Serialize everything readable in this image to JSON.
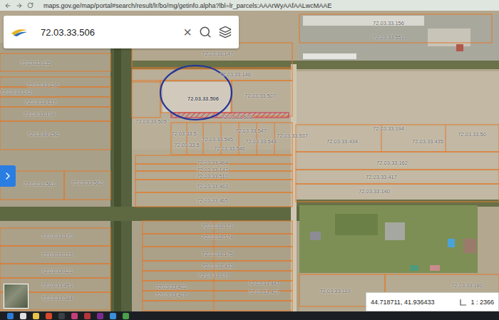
{
  "browser": {
    "url": "maps.gov.ge/map/portal#search/result/lr/bo/mg/getinfo.alpha?lbl=lr_parcels:AAArWyAAfAALwcMAAE"
  },
  "search": {
    "value": "72.03.33.506",
    "clear": "×"
  },
  "parcels": [
    {
      "label": "72.03.33.156",
      "selected": false
    },
    {
      "label": "72.03.33.551",
      "selected": false
    },
    {
      "label": "72.03.33.147",
      "selected": false
    },
    {
      "label": "72.03.33.135",
      "selected": false
    },
    {
      "label": "72.03.33.146",
      "selected": false
    },
    {
      "label": "72.03.33.136",
      "selected": false
    },
    {
      "label": "72.03.33.192",
      "selected": false
    },
    {
      "label": "72.03.33.137",
      "selected": false
    },
    {
      "label": "72.03.33.506",
      "selected": true
    },
    {
      "label": "72.03.33.507",
      "selected": false
    },
    {
      "label": "72.03.33.138",
      "selected": false
    },
    {
      "label": "72.03.33.505",
      "selected": false
    },
    {
      "label": "72.03.33.508",
      "selected": false
    },
    {
      "label": "72.03.33.156",
      "selected": false
    },
    {
      "label": "72.03.33.194",
      "selected": false
    },
    {
      "label": "72.03.33.50",
      "selected": false
    },
    {
      "label": "72.03.33.537",
      "selected": false
    },
    {
      "label": "72.03.33.547",
      "selected": false
    },
    {
      "label": "72.03.33.5",
      "selected": false
    },
    {
      "label": "72.03.33.545",
      "selected": false
    },
    {
      "label": "72.03.33.548",
      "selected": false
    },
    {
      "label": "72.03.33.434",
      "selected": false
    },
    {
      "label": "72.03.33.435",
      "selected": false
    },
    {
      "label": "72.03.33.5",
      "selected": false
    },
    {
      "label": "72.03.33.546",
      "selected": false
    },
    {
      "label": "72.03.33.464",
      "selected": false
    },
    {
      "label": "72.03.33.162",
      "selected": false
    },
    {
      "label": "72.03.33.142",
      "selected": false
    },
    {
      "label": "72.03.33.510",
      "selected": false
    },
    {
      "label": "72.03.33.561",
      "selected": false
    },
    {
      "label": "72.03.33.562",
      "selected": false
    },
    {
      "label": "72.03.33.417",
      "selected": false
    },
    {
      "label": "72.03.33.463",
      "selected": false
    },
    {
      "label": "72.03.33.140",
      "selected": false
    },
    {
      "label": "72.03.33.465",
      "selected": false
    },
    {
      "label": "72.03.33.171",
      "selected": false
    },
    {
      "label": "72.03.33.170",
      "selected": false
    },
    {
      "label": "72.03.33.174",
      "selected": false
    },
    {
      "label": "72.03.33.113",
      "selected": false
    },
    {
      "label": "72.03.33.175",
      "selected": false
    },
    {
      "label": "72.03.33.433",
      "selected": false
    },
    {
      "label": "72.03.33.121",
      "selected": false
    },
    {
      "label": "72.03.33.177",
      "selected": false
    },
    {
      "label": "72.03.33.451",
      "selected": false
    },
    {
      "label": "72.03.33.443",
      "selected": false
    },
    {
      "label": "72.03.33.422",
      "selected": false
    },
    {
      "label": "72.03.33.119",
      "selected": false
    },
    {
      "label": "72.03.33.427",
      "selected": false
    },
    {
      "label": "72.03.33.426",
      "selected": false
    },
    {
      "label": "72.03.33.384",
      "selected": false
    },
    {
      "label": "72.03.33.180",
      "selected": false
    }
  ],
  "status": {
    "coordinates": "44.718711, 41.936433",
    "scale": "1 : 2366"
  }
}
